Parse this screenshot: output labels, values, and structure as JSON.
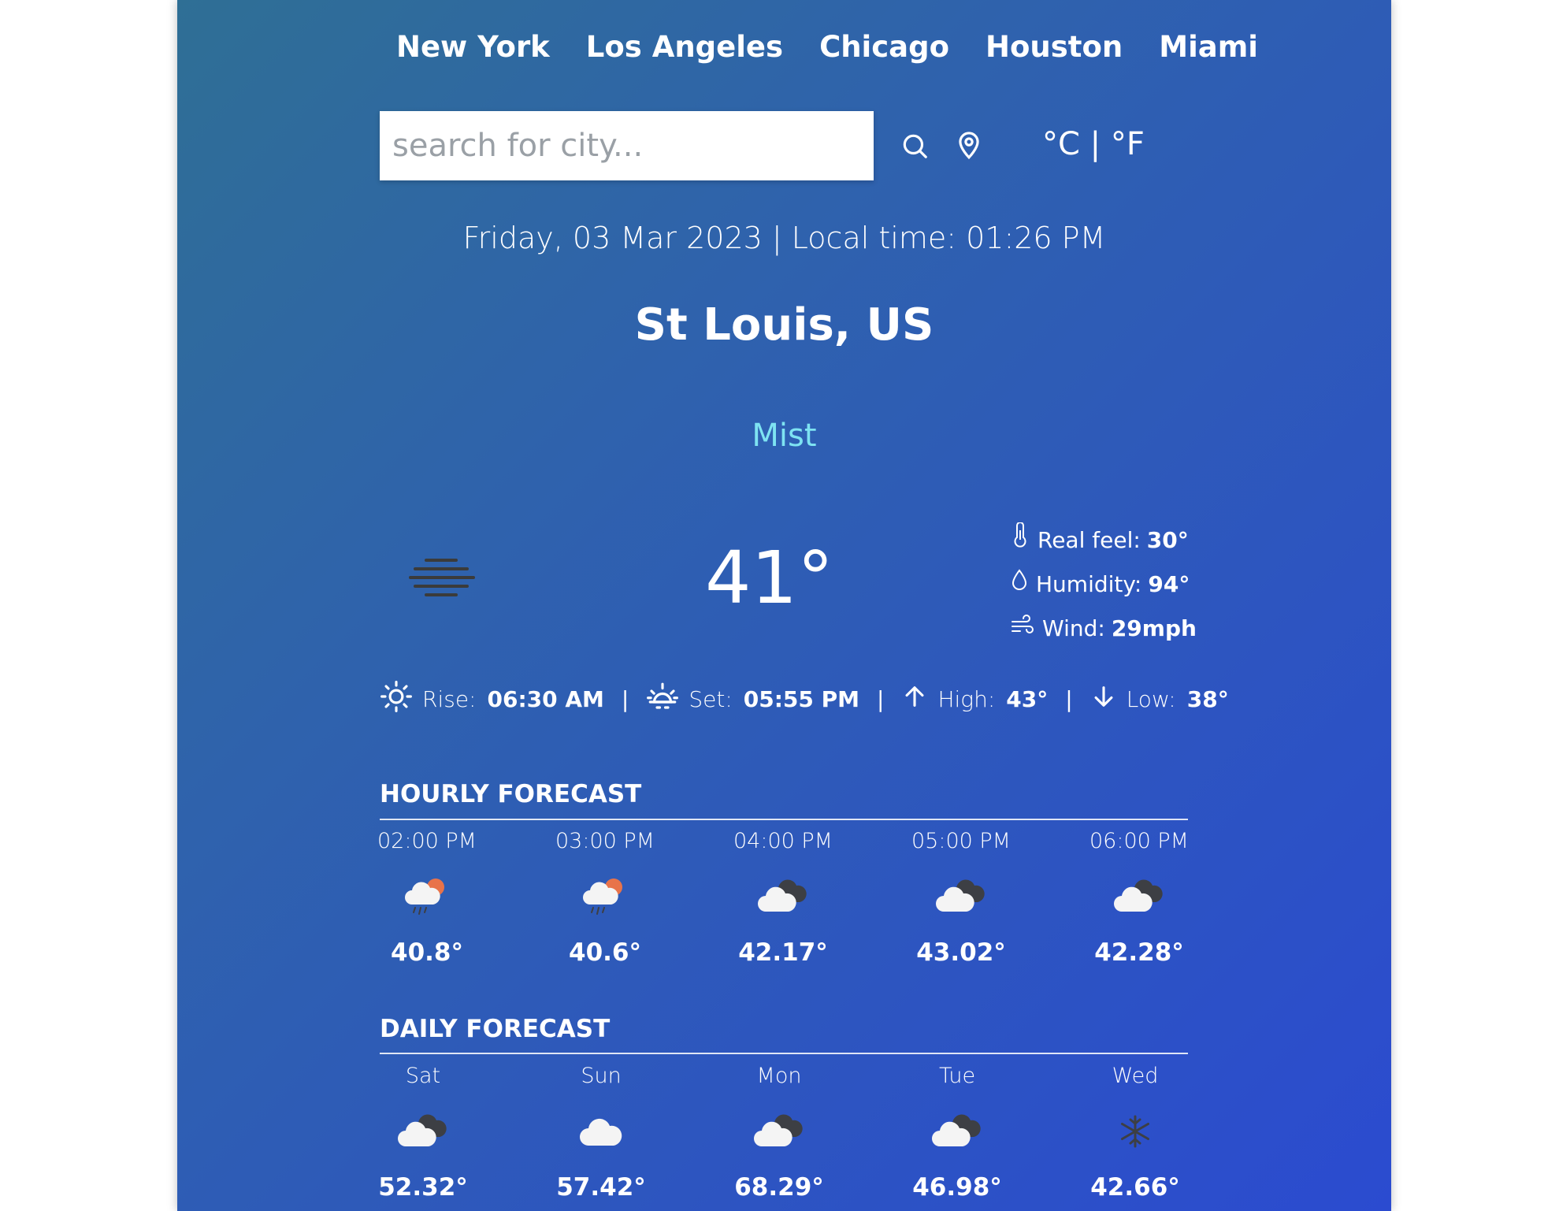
{
  "cities": [
    "New York",
    "Los Angeles",
    "Chicago",
    "Houston",
    "Miami"
  ],
  "search": {
    "placeholder": "search for city..."
  },
  "units": {
    "celsius": "°C",
    "separator": "|",
    "fahrenheit": "°F"
  },
  "datetime": "Friday, 03 Mar 2023 | Local time: 01:26 PM",
  "location": "St Louis, US",
  "condition": "Mist",
  "current": {
    "temp": "41°",
    "real_feel_label": "Real feel:",
    "real_feel": "30°",
    "humidity_label": "Humidity:",
    "humidity": "94°",
    "wind_label": "Wind:",
    "wind": "29mph"
  },
  "sun": {
    "rise_label": "Rise:",
    "rise": "06:30 AM",
    "set_label": "Set:",
    "set": "05:55 PM",
    "high_label": "High:",
    "high": "43°",
    "low_label": "Low:",
    "low": "38°",
    "sep": "|"
  },
  "hourly": {
    "title": "HOURLY FORECAST",
    "items": [
      {
        "label": "02:00 PM",
        "icon": "rain-sun-icon",
        "temp": "40.8°"
      },
      {
        "label": "03:00 PM",
        "icon": "rain-sun-icon",
        "temp": "40.6°"
      },
      {
        "label": "04:00 PM",
        "icon": "cloudy-icon",
        "temp": "42.17°"
      },
      {
        "label": "05:00 PM",
        "icon": "cloudy-icon",
        "temp": "43.02°"
      },
      {
        "label": "06:00 PM",
        "icon": "cloudy-icon",
        "temp": "42.28°"
      }
    ]
  },
  "daily": {
    "title": "DAILY FORECAST",
    "items": [
      {
        "label": "Sat",
        "icon": "cloudy-icon",
        "temp": "52.32°"
      },
      {
        "label": "Sun",
        "icon": "cloud-icon",
        "temp": "57.42°"
      },
      {
        "label": "Mon",
        "icon": "cloudy-icon",
        "temp": "68.29°"
      },
      {
        "label": "Tue",
        "icon": "cloudy-icon",
        "temp": "46.98°"
      },
      {
        "label": "Wed",
        "icon": "snowflake-icon",
        "temp": "42.66°"
      }
    ]
  },
  "colors": {
    "condition": "#7ee3f2",
    "sun_accent": "#e8734a"
  }
}
